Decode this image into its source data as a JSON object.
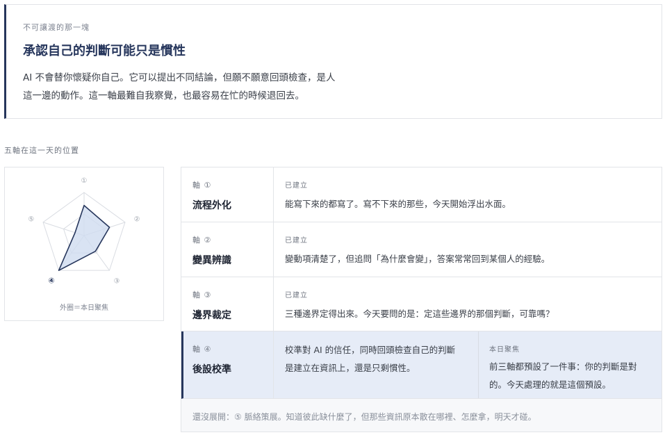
{
  "callout": {
    "eyebrow": "不可讓渡的那一塊",
    "title": "承認自己的判斷可能只是慣性",
    "body_line1": "AI 不會替你懷疑你自己。它可以提出不同結論，但願不願意回頭檢查，是人",
    "body_line2": "這一邊的動作。這一軸最難自我察覺，也最容易在忙的時候退回去。"
  },
  "section_label": "五軸在這一天的位置",
  "radar": {
    "labels": [
      "①",
      "②",
      "③",
      "④",
      "⑤"
    ],
    "caption": "外圈＝本日聚焦",
    "values": [
      0.7,
      0.62,
      0.45,
      1.0,
      0.22
    ],
    "focus_index": 3,
    "colors": {
      "stroke": "#26365c",
      "fill": "#cfdcf0",
      "grid": "#d9dce2"
    }
  },
  "axes": [
    {
      "num": "軸 ①",
      "name": "流程外化",
      "status": "已建立",
      "desc": "能寫下來的都寫了。寫不下來的那些，今天開始浮出水面。"
    },
    {
      "num": "軸 ②",
      "name": "變異辨識",
      "status": "已建立",
      "desc": "變動項清楚了，但追問「為什麼會變」，答案常常回到某個人的經驗。"
    },
    {
      "num": "軸 ③",
      "name": "邊界裁定",
      "status": "已建立",
      "desc": "三種邊界定得出來。今天要問的是：定這些邊界的那個判斷，可靠嗎？"
    }
  ],
  "focus": {
    "num": "軸 ④",
    "name": "後設校準",
    "desc_line1": "校準對 AI 的信任，同時回頭檢查自己的判斷",
    "desc_line2": "是建立在資訊上，還是只剩慣性。",
    "label": "本日聚焦",
    "body_line1": "前三軸都預設了一件事：你的判斷是對",
    "body_line2": "的。今天處理的就是這個預設。"
  },
  "footer_note": "還沒展開：⑤ 脈絡策展。知道彼此缺什麼了，但那些資訊原本散在哪裡、怎麼拿，明天才碰。",
  "colors": {
    "accent": "#26365c",
    "focus_bg": "#e6ecf7"
  }
}
